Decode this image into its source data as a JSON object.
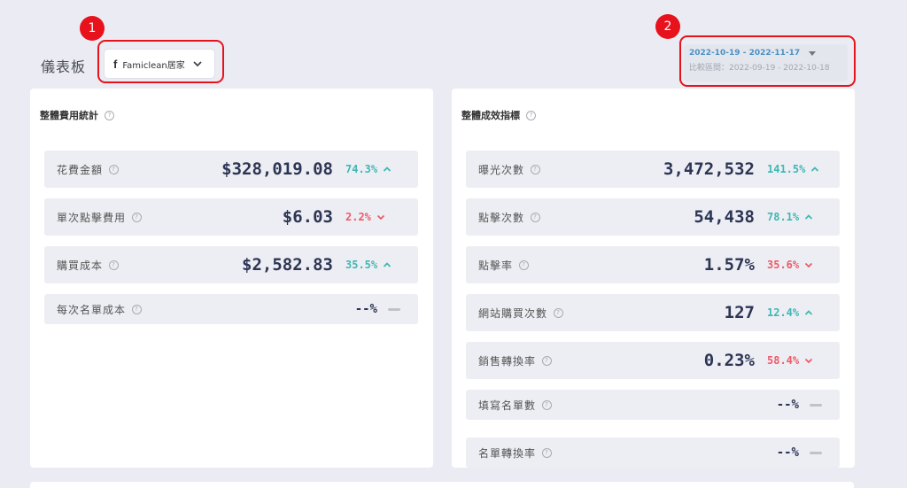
{
  "header": {
    "title": "儀表板",
    "account": {
      "platform_icon": "facebook-icon",
      "name": "Famiclean居家"
    },
    "date": {
      "range": "2022-10-19 - 2022-11-17",
      "compare": "比較區間：2022-09-19 - 2022-10-18"
    }
  },
  "annotations": {
    "badge1": "1",
    "badge2": "2"
  },
  "colors": {
    "up": "#3fb7b4",
    "down": "#ee5a6a",
    "highlight": "#e8121d",
    "date_link": "#4a90c2"
  },
  "cost_card": {
    "title": "整體費用統計",
    "rows": [
      {
        "label": "花費金額",
        "value": "$328,019.08",
        "change": "74.3%",
        "trend": "up"
      },
      {
        "label": "單次點擊費用",
        "value": "$6.03",
        "change": "2.2%",
        "trend": "down"
      },
      {
        "label": "購買成本",
        "value": "$2,582.83",
        "change": "35.5%",
        "trend": "up"
      },
      {
        "label": "每次名單成本",
        "value": "--%",
        "change": "",
        "trend": "flat"
      }
    ]
  },
  "perf_card": {
    "title": "整體成效指標",
    "rows": [
      {
        "label": "曝光次數",
        "value": "3,472,532",
        "change": "141.5%",
        "trend": "up"
      },
      {
        "label": "點擊次數",
        "value": "54,438",
        "change": "78.1%",
        "trend": "up"
      },
      {
        "label": "點擊率",
        "value": "1.57%",
        "change": "35.6%",
        "trend": "down"
      },
      {
        "label": "網站購買次數",
        "value": "127",
        "change": "12.4%",
        "trend": "up"
      },
      {
        "label": "銷售轉換率",
        "value": "0.23%",
        "change": "58.4%",
        "trend": "down"
      },
      {
        "label": "填寫名單數",
        "value": "--%",
        "change": "",
        "trend": "flat"
      },
      {
        "label": "名單轉換率",
        "value": "--%",
        "change": "",
        "trend": "flat"
      }
    ]
  }
}
